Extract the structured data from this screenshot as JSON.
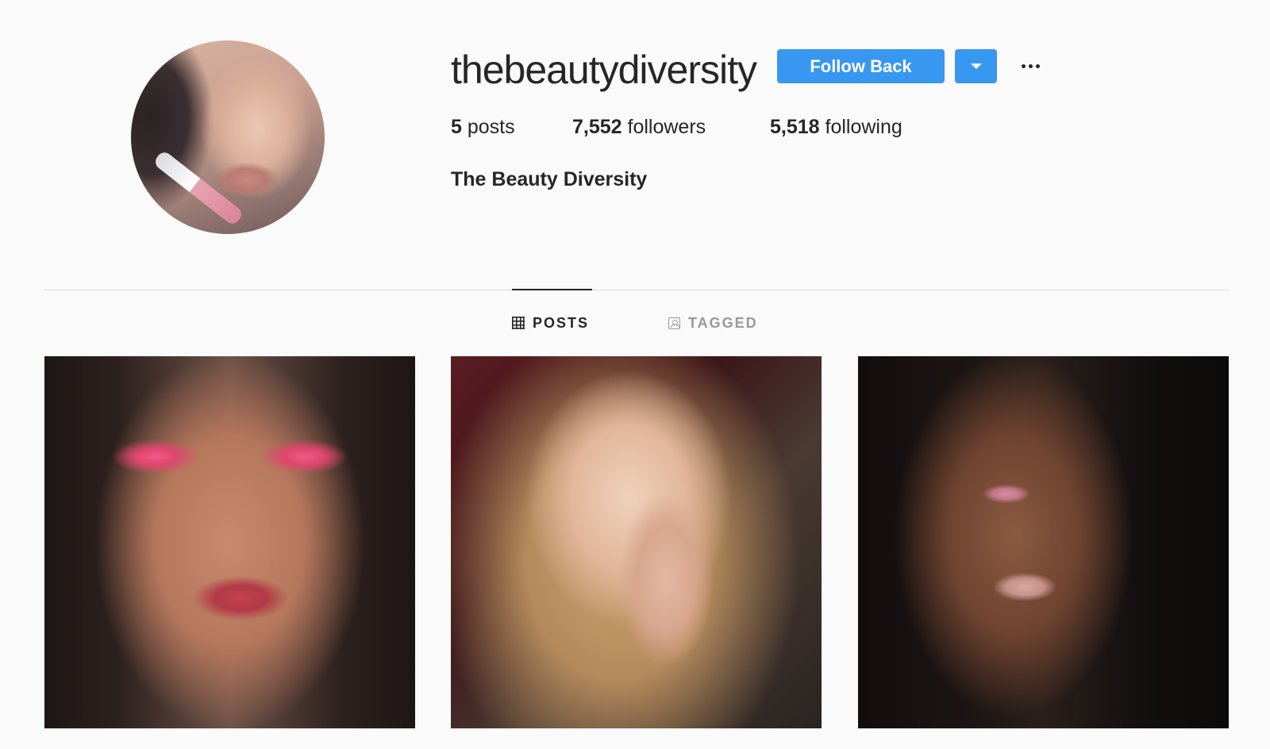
{
  "profile": {
    "username": "thebeautydiversity",
    "full_name": "The Beauty Diversity",
    "avatar_icon": "profile-photo"
  },
  "actions": {
    "follow_label": "Follow Back",
    "accent_color": "#3897f0"
  },
  "stats": {
    "posts_count": "5",
    "posts_label": "posts",
    "followers_count": "7,552",
    "followers_label": "followers",
    "following_count": "5,518",
    "following_label": "following"
  },
  "tabs": [
    {
      "label": "POSTS",
      "icon": "grid-icon",
      "active": true
    },
    {
      "label": "TAGGED",
      "icon": "tag-user-icon",
      "active": false
    }
  ]
}
